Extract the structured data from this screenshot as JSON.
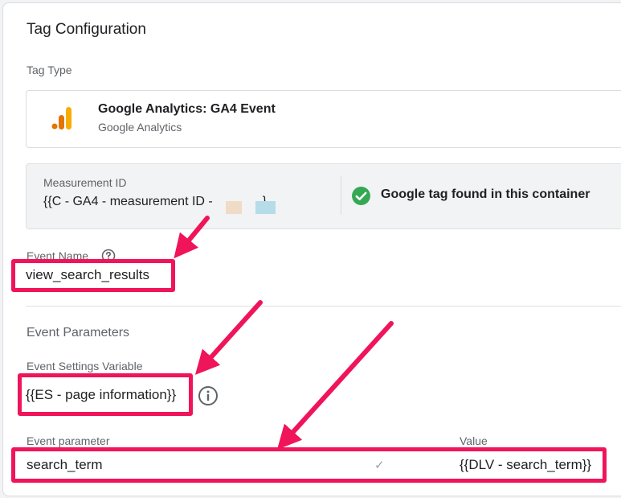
{
  "section_title": "Tag Configuration",
  "tag_type": {
    "label": "Tag Type",
    "name": "Google Analytics: GA4 Event",
    "vendor": "Google Analytics",
    "icon": "google-analytics-icon"
  },
  "measurement": {
    "label": "Measurement ID",
    "value": "{{C - GA4 - measurement ID -",
    "value_suffix": "}",
    "status": "Google tag found in this container",
    "status_icon": "check-circle-icon"
  },
  "event_name": {
    "label": "Event Name",
    "value": "view_search_results",
    "help_icon": "help-icon"
  },
  "event_parameters": {
    "title": "Event Parameters",
    "settings_variable_label": "Event Settings Variable",
    "settings_variable_value": "{{ES - page information}}",
    "info_icon": "info-icon",
    "columns": {
      "param": "Event parameter",
      "value": "Value"
    },
    "rows": [
      {
        "param": "search_term",
        "value": "{{DLV - search_term}}"
      }
    ]
  },
  "colors": {
    "highlight": "#f0145a",
    "check_green": "#34a853",
    "ga_orange": "#f9ab00",
    "ga_dark_orange": "#e37400"
  }
}
